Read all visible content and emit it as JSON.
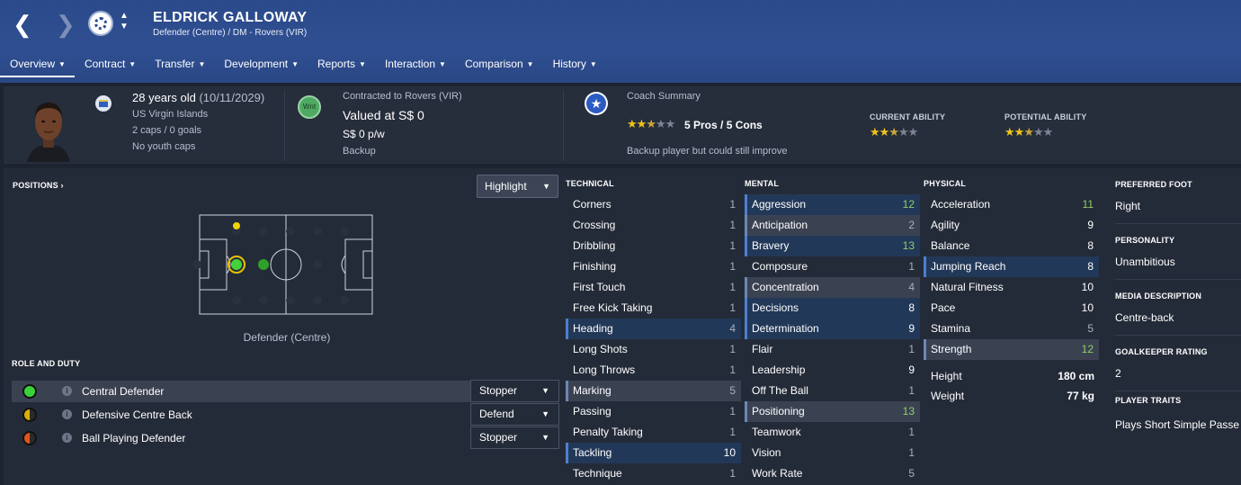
{
  "header": {
    "name": "ELDRICK GALLOWAY",
    "subtitle": "Defender (Centre) / DM - Rovers (VIR)",
    "back_icon": "chevron-left-icon",
    "forward_icon": "chevron-right-icon",
    "gradient_color": "#2f4f92"
  },
  "menu": [
    {
      "label": "Overview"
    },
    {
      "label": "Contract"
    },
    {
      "label": "Transfer"
    },
    {
      "label": "Development"
    },
    {
      "label": "Reports"
    },
    {
      "label": "Interaction"
    },
    {
      "label": "Comparison"
    },
    {
      "label": "History"
    }
  ],
  "summary": {
    "age": "28 years old",
    "dob": "(10/11/2029)",
    "nation": "US Virgin Islands",
    "caps": "2 caps / 0 goals",
    "youth_caps": "No youth caps",
    "contract_badge": "Wnt",
    "contract_label": "Contracted to Rovers (VIR)",
    "value": "Valued at S$ 0",
    "wage": "S$ 0 p/w",
    "squad_status": "Backup",
    "coach_title": "Coach Summary",
    "coach_stars": 2.5,
    "pros_cons": "5 Pros / 5 Cons",
    "coach_note": "Backup player but could still improve",
    "current_ability_label": "CURRENT ABILITY",
    "current_ability_stars": 2.5,
    "potential_ability_label": "POTENTIAL ABILITY",
    "potential_ability_stars": 2.5
  },
  "positions": {
    "title": "POSITIONS",
    "highlight_label": "Highlight",
    "caption": "Defender (Centre)"
  },
  "roles": {
    "title": "ROLE AND DUTY",
    "items": [
      {
        "name": "Central Defender",
        "duty": "Stopper"
      },
      {
        "name": "Defensive Centre Back",
        "duty": "Defend"
      },
      {
        "name": "Ball Playing Defender",
        "duty": "Stopper"
      }
    ]
  },
  "technical": {
    "title": "TECHNICAL",
    "attrs": [
      {
        "name": "Corners",
        "value": "1"
      },
      {
        "name": "Crossing",
        "value": "1"
      },
      {
        "name": "Dribbling",
        "value": "1"
      },
      {
        "name": "Finishing",
        "value": "1"
      },
      {
        "name": "First Touch",
        "value": "1"
      },
      {
        "name": "Free Kick Taking",
        "value": "1"
      },
      {
        "name": "Heading",
        "value": "4"
      },
      {
        "name": "Long Shots",
        "value": "1"
      },
      {
        "name": "Long Throws",
        "value": "1"
      },
      {
        "name": "Marking",
        "value": "5"
      },
      {
        "name": "Passing",
        "value": "1"
      },
      {
        "name": "Penalty Taking",
        "value": "1"
      },
      {
        "name": "Tackling",
        "value": "10"
      },
      {
        "name": "Technique",
        "value": "1"
      }
    ]
  },
  "mental": {
    "title": "MENTAL",
    "attrs": [
      {
        "name": "Aggression",
        "value": "12"
      },
      {
        "name": "Anticipation",
        "value": "2"
      },
      {
        "name": "Bravery",
        "value": "13"
      },
      {
        "name": "Composure",
        "value": "1"
      },
      {
        "name": "Concentration",
        "value": "4"
      },
      {
        "name": "Decisions",
        "value": "8"
      },
      {
        "name": "Determination",
        "value": "9"
      },
      {
        "name": "Flair",
        "value": "1"
      },
      {
        "name": "Leadership",
        "value": "9"
      },
      {
        "name": "Off The Ball",
        "value": "1"
      },
      {
        "name": "Positioning",
        "value": "13"
      },
      {
        "name": "Teamwork",
        "value": "1"
      },
      {
        "name": "Vision",
        "value": "1"
      },
      {
        "name": "Work Rate",
        "value": "5"
      }
    ]
  },
  "physical": {
    "title": "PHYSICAL",
    "attrs": [
      {
        "name": "Acceleration",
        "value": "11"
      },
      {
        "name": "Agility",
        "value": "9"
      },
      {
        "name": "Balance",
        "value": "8"
      },
      {
        "name": "Jumping Reach",
        "value": "8"
      },
      {
        "name": "Natural Fitness",
        "value": "10"
      },
      {
        "name": "Pace",
        "value": "10"
      },
      {
        "name": "Stamina",
        "value": "5"
      },
      {
        "name": "Strength",
        "value": "12"
      }
    ],
    "height_label": "Height",
    "height": "180 cm",
    "weight_label": "Weight",
    "weight": "77 kg"
  },
  "info": {
    "foot_label": "PREFERRED FOOT",
    "foot": "Right",
    "personality_label": "PERSONALITY",
    "personality": "Unambitious",
    "media_label": "MEDIA DESCRIPTION",
    "media": "Centre-back",
    "gk_label": "GOALKEEPER RATING",
    "gk": "2",
    "traits_label": "PLAYER TRAITS",
    "traits": "Plays Short Simple Passe"
  },
  "colors": {
    "accent_green": "#8fcf64",
    "highlight_blue": "#223858",
    "star_gold": "#f0c419"
  }
}
